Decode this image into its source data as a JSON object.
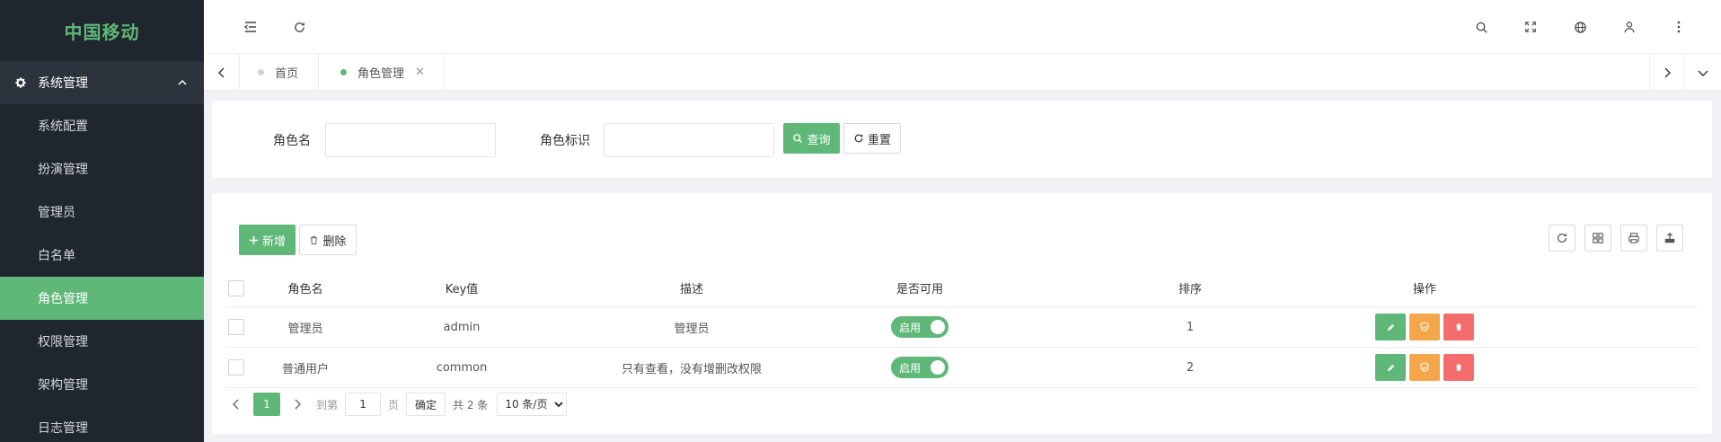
{
  "app": {
    "title": "中国移动"
  },
  "sidebar": {
    "group_label": "系统管理",
    "items": [
      {
        "label": "系统配置"
      },
      {
        "label": "扮演管理"
      },
      {
        "label": "管理员"
      },
      {
        "label": "白名单"
      },
      {
        "label": "角色管理",
        "active": true
      },
      {
        "label": "权限管理"
      },
      {
        "label": "架构管理"
      },
      {
        "label": "日志管理"
      }
    ]
  },
  "header": {
    "icons": [
      "menu-fold-icon",
      "refresh-icon",
      "search-icon",
      "fullscreen-icon",
      "language-icon",
      "user-icon",
      "more-icon"
    ]
  },
  "tabs": [
    {
      "label": "首页",
      "active": false
    },
    {
      "label": "角色管理",
      "active": true,
      "closable": true
    }
  ],
  "search": {
    "role_name_label": "角色名",
    "role_name_value": "",
    "role_key_label": "角色标识",
    "role_key_value": "",
    "query_label": "查询",
    "reset_label": "重置"
  },
  "toolbar": {
    "add_label": "新增",
    "delete_label": "删除",
    "tool_icons": [
      "refresh-icon",
      "columns-icon",
      "print-icon",
      "export-icon"
    ]
  },
  "table": {
    "headers": [
      "角色名",
      "Key值",
      "描述",
      "是否可用",
      "排序",
      "操作"
    ],
    "rows": [
      {
        "name": "管理员",
        "key": "admin",
        "desc": "管理员",
        "status": "启用",
        "sort": "1"
      },
      {
        "name": "普通用户",
        "key": "common",
        "desc": "只有查看，没有增删改权限",
        "status": "启用",
        "sort": "2"
      }
    ]
  },
  "pager": {
    "current": "1",
    "goto_label": "到第",
    "goto_value": "1",
    "page_label": "页",
    "confirm_label": "确定",
    "total_label": "共 2 条",
    "page_size": "10 条/页"
  },
  "colors": {
    "primary": "#5fb878",
    "sidebar_bg": "#20262e",
    "warn": "#f5a64a",
    "danger": "#f56c6c"
  }
}
